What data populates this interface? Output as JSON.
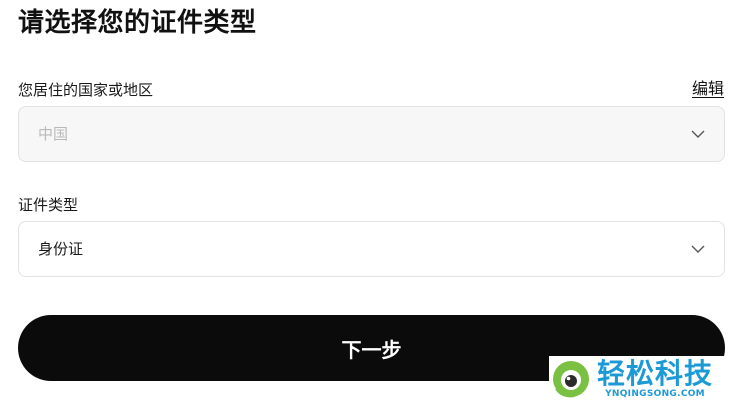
{
  "page": {
    "title": "请选择您的证件类型"
  },
  "country_field": {
    "label": "您居住的国家或地区",
    "edit_label": "编辑",
    "value": "中国",
    "disabled": true,
    "icon": "chevron-down-icon"
  },
  "doctype_field": {
    "label": "证件类型",
    "value": "身份证",
    "icon": "chevron-down-icon"
  },
  "actions": {
    "next_label": "下一步"
  },
  "watermark": {
    "text_cn": "轻松科技",
    "text_en": "YNQINGSONG.COM"
  },
  "colors": {
    "primary_button": "#0b0b0b",
    "disabled_field_bg": "#f7f7f7",
    "border": "#e2e2e2",
    "watermark_blue": "#1c9ad6",
    "watermark_green": "#7ac143"
  }
}
